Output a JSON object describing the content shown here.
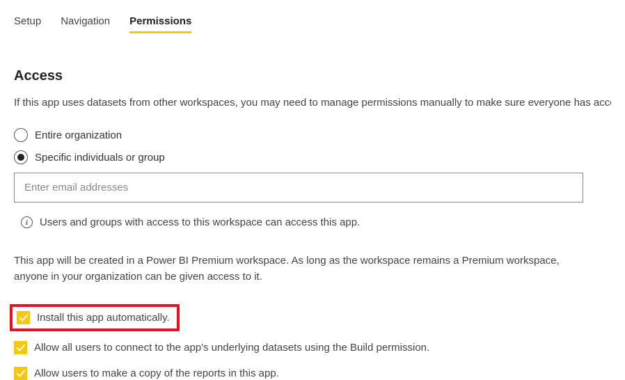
{
  "tabs": {
    "setup": "Setup",
    "navigation": "Navigation",
    "permissions": "Permissions"
  },
  "section": {
    "title": "Access",
    "description": "If this app uses datasets from other workspaces, you may need to manage permissions manually to make sure everyone has access t"
  },
  "radios": {
    "entire_org": "Entire organization",
    "specific": "Specific individuals or group"
  },
  "email": {
    "placeholder": "Enter email addresses",
    "value": ""
  },
  "info": {
    "text": "Users and groups with access to this workspace can access this app."
  },
  "premium_note": "This app will be created in a Power BI Premium workspace. As long as the workspace remains a Premium workspace, anyone in your organization can be given access to it.",
  "checkboxes": {
    "install_auto": "Install this app automatically.",
    "allow_connect": "Allow all users to connect to the app's underlying datasets using the Build permission.",
    "allow_copy": "Allow users to make a copy of the reports in this app."
  },
  "colors": {
    "accent": "#f2c811",
    "highlight": "#e81123"
  }
}
